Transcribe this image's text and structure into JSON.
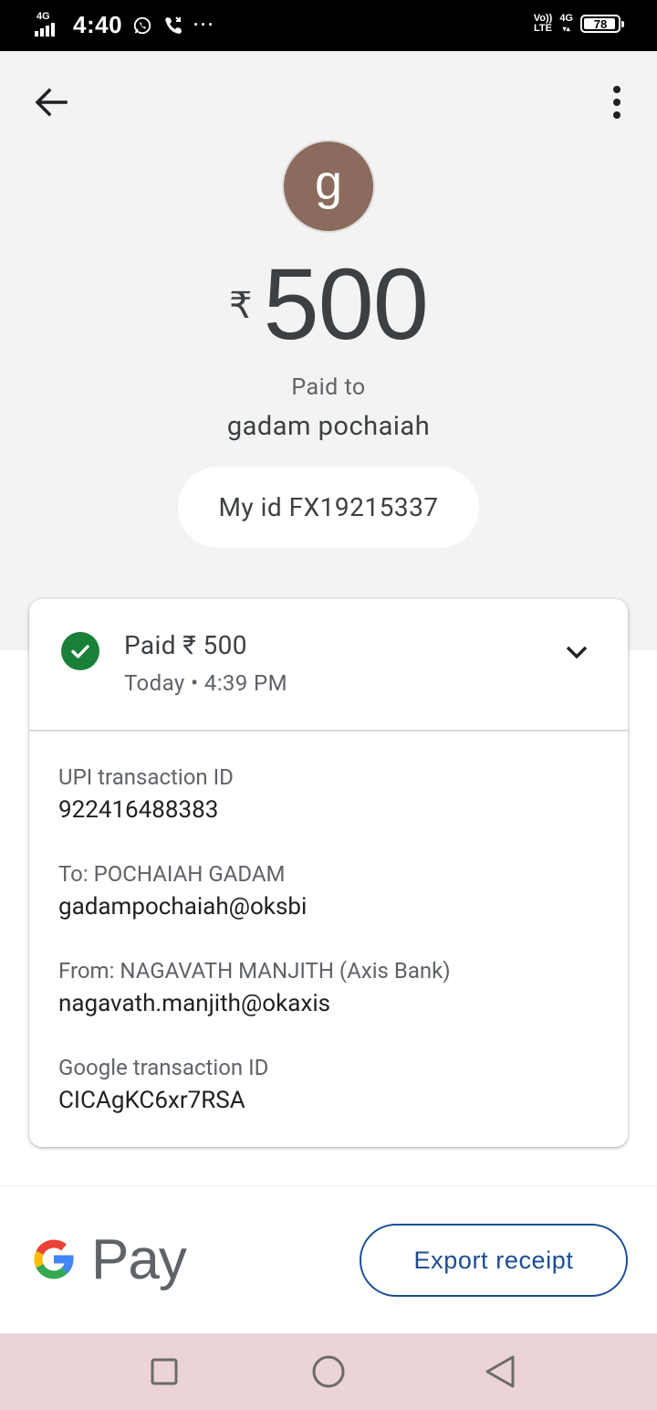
{
  "status_bar": {
    "network_label": "4G",
    "time": "4:40",
    "more_notifications": "···",
    "volte_top": "Vo))",
    "volte_bottom": "LTE",
    "network_right": "4G",
    "battery": "78"
  },
  "header": {
    "avatar_letter": "g",
    "currency_symbol": "₹",
    "amount": "500",
    "paid_to_label": "Paid to",
    "payee_name": "gadam pochaiah",
    "note": "My id FX19215337"
  },
  "transaction": {
    "title": "Paid ₹ 500",
    "time": "Today • 4:39 PM",
    "details": [
      {
        "label": "UPI transaction ID",
        "value": "922416488383"
      },
      {
        "label": "To: POCHAIAH  GADAM",
        "value": "gadampochaiah@oksbi"
      },
      {
        "label": "From: NAGAVATH MANJITH (Axis Bank)",
        "value": "nagavath.manjith@okaxis"
      },
      {
        "label": "Google transaction ID",
        "value": "CICAgKC6xr7RSA"
      }
    ]
  },
  "footer": {
    "logo_text": "Pay",
    "export_label": "Export receipt"
  },
  "colors": {
    "success_green": "#188038",
    "brand_blue": "#1a4d94",
    "avatar_brown": "#8b6b5d",
    "nav_bar_pink": "#ecd3d6"
  }
}
